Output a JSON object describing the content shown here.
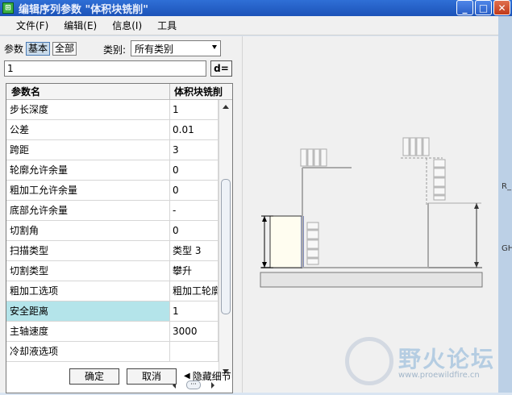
{
  "window": {
    "title": "编辑序列参数 \"体积块铣削\"",
    "app_icon": "pro-e-icon",
    "buttons": [
      "minimize-icon",
      "maximize-icon",
      "close-icon"
    ]
  },
  "menu": [
    {
      "label": "文件(F)"
    },
    {
      "label": "编辑(E)"
    },
    {
      "label": "信息(I)"
    },
    {
      "label": "工具"
    }
  ],
  "params": {
    "label": "参数",
    "tab_basic": "基本",
    "tab_all": "全部",
    "category_label": "类别:",
    "category_value": "所有类别"
  },
  "input": {
    "value": "1",
    "deq_label": "d="
  },
  "table": {
    "header_name": "参数名",
    "header_value": "体积块铣削",
    "rows": [
      {
        "name": "步长深度",
        "value": "1"
      },
      {
        "name": "公差",
        "value": "0.01"
      },
      {
        "name": "跨距",
        "value": "3"
      },
      {
        "name": "轮廓允许余量",
        "value": "0"
      },
      {
        "name": "粗加工允许余量",
        "value": "0"
      },
      {
        "name": "底部允许余量",
        "value": "-"
      },
      {
        "name": "切割角",
        "value": "0"
      },
      {
        "name": "扫描类型",
        "value": "类型 3"
      },
      {
        "name": "切割类型",
        "value": "攀升"
      },
      {
        "name": "粗加工选项",
        "value": "粗加工轮廓"
      },
      {
        "name": "安全距离",
        "value": "1"
      },
      {
        "name": "主轴速度",
        "value": "3000"
      },
      {
        "name": "冷却液选项",
        "value": ""
      }
    ],
    "selected_row": "安全距离"
  },
  "actions": {
    "ok": "确定",
    "cancel": "取消",
    "hide_detail": "隐藏细节"
  },
  "side_strip": {
    "label_top": "R_",
    "label_bottom": "GH"
  },
  "watermark": {
    "title": "野火论坛",
    "url": "www.proewildfire.cn"
  },
  "colors": {
    "titlebar": "#2a63cc",
    "selected_row": "#b4e4ea",
    "diagram_bar": "#1a2e8a"
  }
}
